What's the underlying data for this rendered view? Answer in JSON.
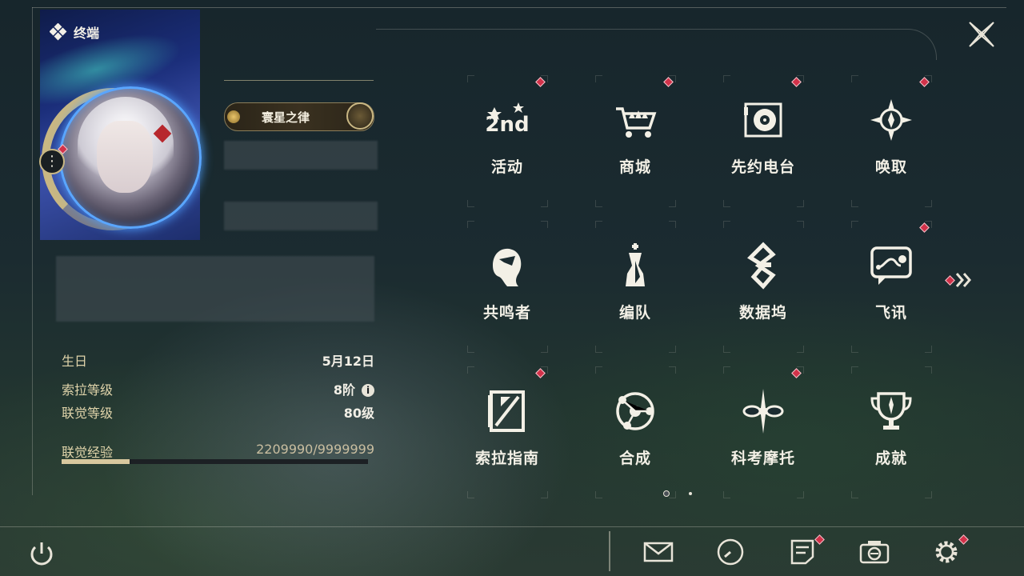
{
  "header": {
    "title": "终端"
  },
  "profile": {
    "title_badge": "寰星之律",
    "info": [
      {
        "label": "生日",
        "value": "5月12日"
      },
      {
        "label": "索拉等级",
        "value": "8阶"
      },
      {
        "label": "联觉等级",
        "value": "80级"
      }
    ],
    "exp": {
      "label": "联觉经验",
      "value": "2209990/9999999",
      "progress": 0.221
    }
  },
  "menu": {
    "items": [
      {
        "label": "活动",
        "icon": "event-2nd-anniversary-icon",
        "badge": true
      },
      {
        "label": "商城",
        "icon": "shop-cart-icon",
        "badge": true
      },
      {
        "label": "先约电台",
        "icon": "radio-vinyl-icon",
        "badge": true
      },
      {
        "label": "唤取",
        "icon": "convene-compass-icon",
        "badge": true
      },
      {
        "label": "共鸣者",
        "icon": "resonator-portrait-icon",
        "badge": false
      },
      {
        "label": "编队",
        "icon": "team-chess-icon",
        "badge": false
      },
      {
        "label": "数据坞",
        "icon": "data-bank-icon",
        "badge": false
      },
      {
        "label": "飞讯",
        "icon": "message-chat-icon",
        "badge": true
      },
      {
        "label": "索拉指南",
        "icon": "guide-book-icon",
        "badge": true
      },
      {
        "label": "合成",
        "icon": "synthesis-orbit-icon",
        "badge": false
      },
      {
        "label": "科考摩托",
        "icon": "motorbike-icon",
        "badge": true
      },
      {
        "label": "成就",
        "icon": "achievement-trophy-icon",
        "badge": false
      }
    ],
    "page": {
      "current": 1,
      "total": 2
    }
  },
  "bottom_bar": {
    "buttons": [
      "power-icon",
      "mail-icon",
      "clock-icon",
      "notice-icon",
      "camera-icon",
      "settings-gear-icon"
    ]
  },
  "colors": {
    "accent_gold": "#c9b783",
    "badge_red": "#d2324a",
    "text": "#f3f0e6"
  }
}
